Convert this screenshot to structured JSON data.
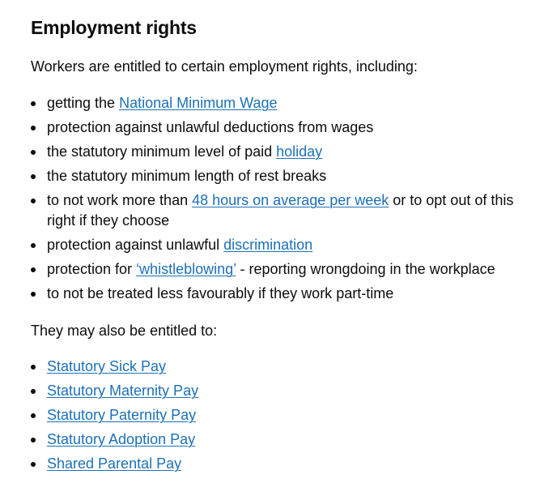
{
  "heading": "Employment rights",
  "intro": "Workers are entitled to certain employment rights, including:",
  "rights": [
    {
      "before": "getting the ",
      "link": "National Minimum Wage",
      "after": ""
    },
    {
      "before": "protection against unlawful deductions from wages",
      "link": "",
      "after": ""
    },
    {
      "before": "the statutory minimum level of paid ",
      "link": "holiday",
      "after": ""
    },
    {
      "before": "the statutory minimum length of rest breaks",
      "link": "",
      "after": ""
    },
    {
      "before": "to not work more than ",
      "link": "48 hours on average per week",
      "after": " or to opt out of this right if they choose"
    },
    {
      "before": "protection against unlawful ",
      "link": "discrimination",
      "after": ""
    },
    {
      "before": "protection for ",
      "link": "‘whistleblowing’",
      "after": " - reporting wrongdoing in the workplace"
    },
    {
      "before": "to not be treated less favourably if they work part-time",
      "link": "",
      "after": ""
    }
  ],
  "also_intro": "They may also be entitled to:",
  "also": [
    {
      "before": "",
      "link": "Statutory Sick Pay",
      "after": ""
    },
    {
      "before": "",
      "link": "Statutory Maternity Pay",
      "after": ""
    },
    {
      "before": "",
      "link": "Statutory Paternity Pay",
      "after": ""
    },
    {
      "before": "",
      "link": "Statutory Adoption Pay",
      "after": ""
    },
    {
      "before": "",
      "link": "Shared Parental Pay",
      "after": ""
    }
  ],
  "colors": {
    "text": "#0b0c0c",
    "link": "#1d70b8"
  }
}
